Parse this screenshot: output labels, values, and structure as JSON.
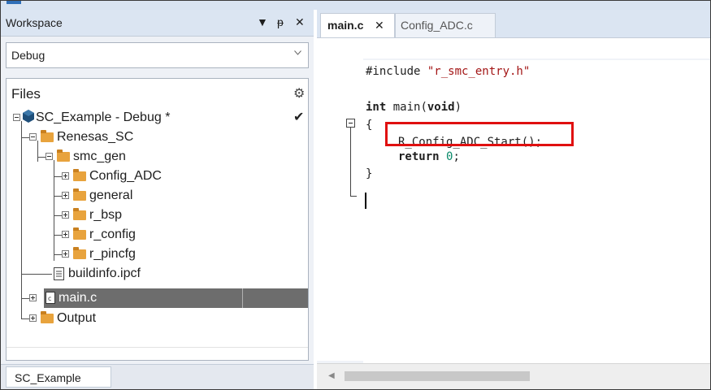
{
  "workspace": {
    "title": "Workspace",
    "menu_glyph": "▼",
    "pin_glyph": "ᵽ",
    "close_glyph": "✕",
    "config_value": "Debug",
    "files_label": "Files",
    "tree": {
      "project": "SC_Example - Debug *",
      "renesas_sc": "Renesas_SC",
      "smc_gen": "smc_gen",
      "config_adc": "Config_ADC",
      "general": "general",
      "r_bsp": "r_bsp",
      "r_config": "r_config",
      "r_pincfg": "r_pincfg",
      "buildinfo": "buildinfo.ipcf",
      "main_c": "main.c",
      "output": "Output"
    },
    "bottom_tab": "SC_Example"
  },
  "editor": {
    "tabs": [
      {
        "label": "main.c",
        "active": true
      },
      {
        "label": "Config_ADC.c",
        "active": false
      }
    ],
    "close_glyph": "✕",
    "code": {
      "l1_directive": "#include ",
      "l1_string": "\"r_smc_entry.h\"",
      "l2_type": "int",
      "l2_rest": " main(",
      "l2_param": "void",
      "l2_close": ")",
      "l3": "{",
      "l4": "R_Config_ADC_Start();",
      "l5_kw": "return",
      "l5_num": "0",
      "l5_end": ";",
      "l6": "}"
    }
  },
  "colors": {
    "highlight_box": "#e01010",
    "selection": "#6d6d6d",
    "folder": "#e8a33d"
  }
}
